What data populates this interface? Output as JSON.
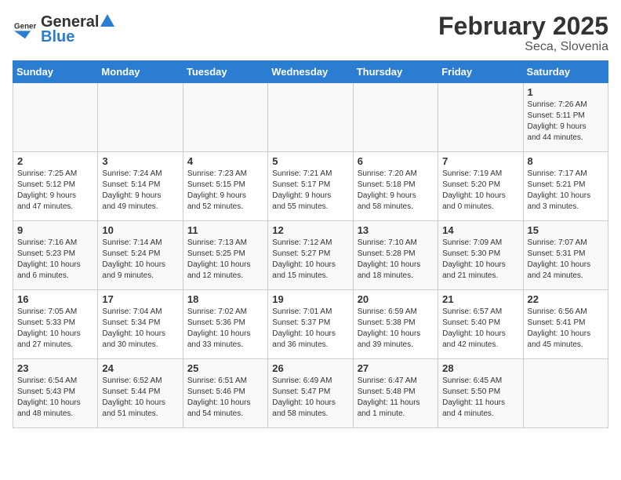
{
  "header": {
    "logo_general": "General",
    "logo_blue": "Blue",
    "title": "February 2025",
    "subtitle": "Seca, Slovenia"
  },
  "weekdays": [
    "Sunday",
    "Monday",
    "Tuesday",
    "Wednesday",
    "Thursday",
    "Friday",
    "Saturday"
  ],
  "weeks": [
    [
      {
        "day": "",
        "info": ""
      },
      {
        "day": "",
        "info": ""
      },
      {
        "day": "",
        "info": ""
      },
      {
        "day": "",
        "info": ""
      },
      {
        "day": "",
        "info": ""
      },
      {
        "day": "",
        "info": ""
      },
      {
        "day": "1",
        "info": "Sunrise: 7:26 AM\nSunset: 5:11 PM\nDaylight: 9 hours\nand 44 minutes."
      }
    ],
    [
      {
        "day": "2",
        "info": "Sunrise: 7:25 AM\nSunset: 5:12 PM\nDaylight: 9 hours\nand 47 minutes."
      },
      {
        "day": "3",
        "info": "Sunrise: 7:24 AM\nSunset: 5:14 PM\nDaylight: 9 hours\nand 49 minutes."
      },
      {
        "day": "4",
        "info": "Sunrise: 7:23 AM\nSunset: 5:15 PM\nDaylight: 9 hours\nand 52 minutes."
      },
      {
        "day": "5",
        "info": "Sunrise: 7:21 AM\nSunset: 5:17 PM\nDaylight: 9 hours\nand 55 minutes."
      },
      {
        "day": "6",
        "info": "Sunrise: 7:20 AM\nSunset: 5:18 PM\nDaylight: 9 hours\nand 58 minutes."
      },
      {
        "day": "7",
        "info": "Sunrise: 7:19 AM\nSunset: 5:20 PM\nDaylight: 10 hours\nand 0 minutes."
      },
      {
        "day": "8",
        "info": "Sunrise: 7:17 AM\nSunset: 5:21 PM\nDaylight: 10 hours\nand 3 minutes."
      }
    ],
    [
      {
        "day": "9",
        "info": "Sunrise: 7:16 AM\nSunset: 5:23 PM\nDaylight: 10 hours\nand 6 minutes."
      },
      {
        "day": "10",
        "info": "Sunrise: 7:14 AM\nSunset: 5:24 PM\nDaylight: 10 hours\nand 9 minutes."
      },
      {
        "day": "11",
        "info": "Sunrise: 7:13 AM\nSunset: 5:25 PM\nDaylight: 10 hours\nand 12 minutes."
      },
      {
        "day": "12",
        "info": "Sunrise: 7:12 AM\nSunset: 5:27 PM\nDaylight: 10 hours\nand 15 minutes."
      },
      {
        "day": "13",
        "info": "Sunrise: 7:10 AM\nSunset: 5:28 PM\nDaylight: 10 hours\nand 18 minutes."
      },
      {
        "day": "14",
        "info": "Sunrise: 7:09 AM\nSunset: 5:30 PM\nDaylight: 10 hours\nand 21 minutes."
      },
      {
        "day": "15",
        "info": "Sunrise: 7:07 AM\nSunset: 5:31 PM\nDaylight: 10 hours\nand 24 minutes."
      }
    ],
    [
      {
        "day": "16",
        "info": "Sunrise: 7:05 AM\nSunset: 5:33 PM\nDaylight: 10 hours\nand 27 minutes."
      },
      {
        "day": "17",
        "info": "Sunrise: 7:04 AM\nSunset: 5:34 PM\nDaylight: 10 hours\nand 30 minutes."
      },
      {
        "day": "18",
        "info": "Sunrise: 7:02 AM\nSunset: 5:36 PM\nDaylight: 10 hours\nand 33 minutes."
      },
      {
        "day": "19",
        "info": "Sunrise: 7:01 AM\nSunset: 5:37 PM\nDaylight: 10 hours\nand 36 minutes."
      },
      {
        "day": "20",
        "info": "Sunrise: 6:59 AM\nSunset: 5:38 PM\nDaylight: 10 hours\nand 39 minutes."
      },
      {
        "day": "21",
        "info": "Sunrise: 6:57 AM\nSunset: 5:40 PM\nDaylight: 10 hours\nand 42 minutes."
      },
      {
        "day": "22",
        "info": "Sunrise: 6:56 AM\nSunset: 5:41 PM\nDaylight: 10 hours\nand 45 minutes."
      }
    ],
    [
      {
        "day": "23",
        "info": "Sunrise: 6:54 AM\nSunset: 5:43 PM\nDaylight: 10 hours\nand 48 minutes."
      },
      {
        "day": "24",
        "info": "Sunrise: 6:52 AM\nSunset: 5:44 PM\nDaylight: 10 hours\nand 51 minutes."
      },
      {
        "day": "25",
        "info": "Sunrise: 6:51 AM\nSunset: 5:46 PM\nDaylight: 10 hours\nand 54 minutes."
      },
      {
        "day": "26",
        "info": "Sunrise: 6:49 AM\nSunset: 5:47 PM\nDaylight: 10 hours\nand 58 minutes."
      },
      {
        "day": "27",
        "info": "Sunrise: 6:47 AM\nSunset: 5:48 PM\nDaylight: 11 hours\nand 1 minute."
      },
      {
        "day": "28",
        "info": "Sunrise: 6:45 AM\nSunset: 5:50 PM\nDaylight: 11 hours\nand 4 minutes."
      },
      {
        "day": "",
        "info": ""
      }
    ]
  ]
}
